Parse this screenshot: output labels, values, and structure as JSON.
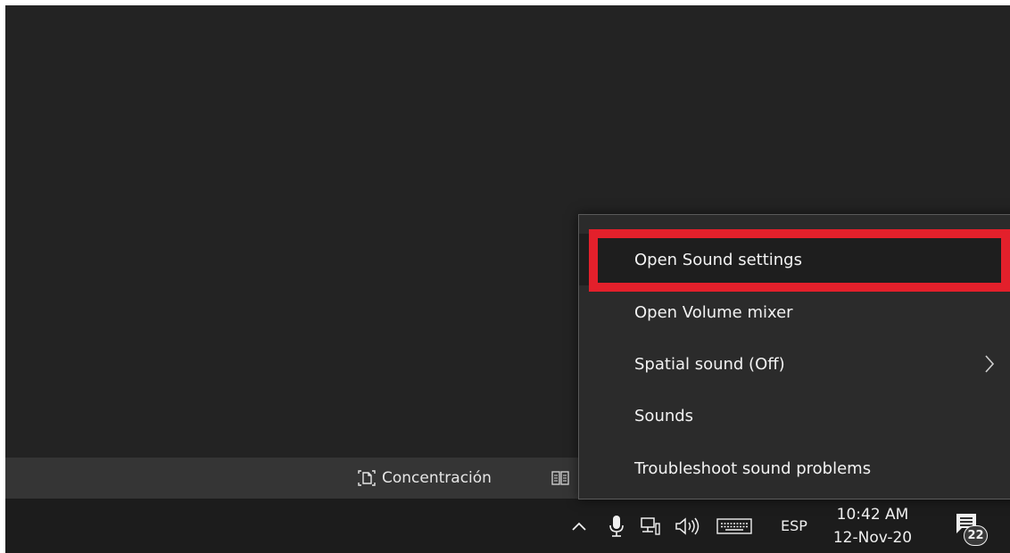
{
  "status_bar": {
    "focus_label": "Concentración",
    "focus_icon": "focus-mode-icon",
    "reader_icon": "book-icon"
  },
  "taskbar": {
    "tray_icons": [
      "chevron-up-icon",
      "microphone-icon",
      "network-icon",
      "speaker-icon",
      "keyboard-icon"
    ],
    "language": "ESP",
    "time": "10:42 AM",
    "date": "12-Nov-20",
    "notification_count": "22"
  },
  "context_menu": {
    "items": [
      {
        "label": "Open Sound settings",
        "highlighted": true
      },
      {
        "label": "Open Volume mixer"
      },
      {
        "label": "Spatial sound (Off)",
        "has_submenu": true
      },
      {
        "label": "Sounds"
      },
      {
        "label": "Troubleshoot sound problems"
      }
    ]
  },
  "colors": {
    "highlight": "#e3202b",
    "menu_bg": "#2b2b2b",
    "taskbar_bg": "#1c1c1c",
    "desktop_bg": "#232323"
  }
}
